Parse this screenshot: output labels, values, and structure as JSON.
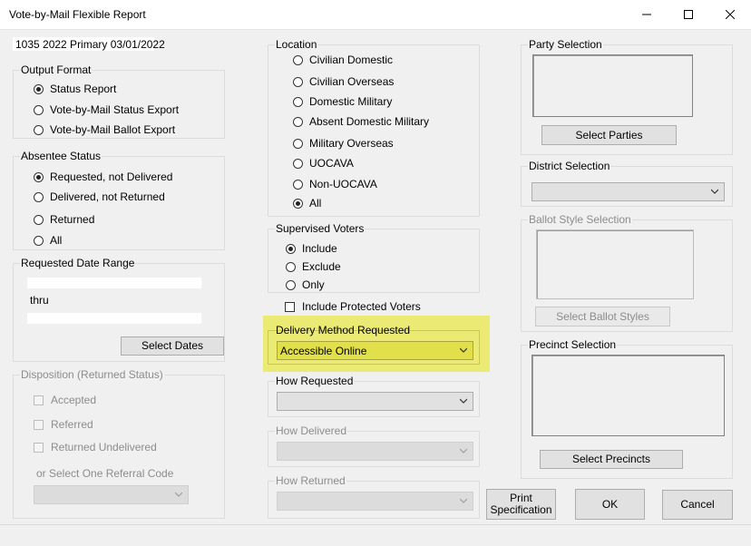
{
  "window": {
    "title": "Vote-by-Mail Flexible Report"
  },
  "election_label": "1035 2022 Primary 03/01/2022",
  "output_format": {
    "label": "Output Format",
    "options": [
      "Status Report",
      "Vote-by-Mail Status Export",
      "Vote-by-Mail Ballot Export"
    ],
    "selected": 0
  },
  "absentee_status": {
    "label": "Absentee Status",
    "options": [
      "Requested, not Delivered",
      "Delivered, not Returned",
      "Returned",
      "All"
    ],
    "selected": 0
  },
  "date_range": {
    "label": "Requested Date Range",
    "from_value": "",
    "thru_label": "thru",
    "to_value": "",
    "button": "Select Dates"
  },
  "disposition": {
    "label": "Disposition (Returned Status)",
    "checks": [
      "Accepted",
      "Referred",
      "Returned Undelivered"
    ],
    "referral_label": "or Select One Referral Code",
    "referral_value": ""
  },
  "location": {
    "label": "Location",
    "options": [
      "Civilian Domestic",
      "Civilian Overseas",
      "Domestic Military",
      "Absent Domestic Military",
      "Military Overseas",
      "UOCAVA",
      "Non-UOCAVA",
      "All"
    ],
    "selected": 7
  },
  "supervised": {
    "label": "Supervised Voters",
    "options": [
      "Include",
      "Exclude",
      "Only"
    ],
    "selected": 0
  },
  "protected": {
    "label": "Include Protected Voters",
    "checked": false
  },
  "delivery_method": {
    "label": "Delivery Method Requested",
    "value": "Accessible Online"
  },
  "how_requested": {
    "label": "How Requested",
    "value": ""
  },
  "how_delivered": {
    "label": "How Delivered",
    "value": ""
  },
  "how_returned": {
    "label": "How Returned",
    "value": ""
  },
  "party": {
    "label": "Party Selection",
    "button": "Select Parties"
  },
  "district": {
    "label": "District Selection",
    "value": ""
  },
  "ballot_style": {
    "label": "Ballot Style Selection",
    "button": "Select Ballot Styles"
  },
  "precinct": {
    "label": "Precinct Selection",
    "button": "Select Precincts"
  },
  "buttons": {
    "print_line1": "Print",
    "print_line2": "Specification",
    "ok": "OK",
    "cancel": "Cancel"
  },
  "icons": {
    "minimize": "minimize-icon",
    "maximize": "maximize-icon",
    "close": "close-icon",
    "dropdown": "chevron-down-icon"
  },
  "colors": {
    "highlight": "#e6e632",
    "accent": "#0078d7"
  }
}
